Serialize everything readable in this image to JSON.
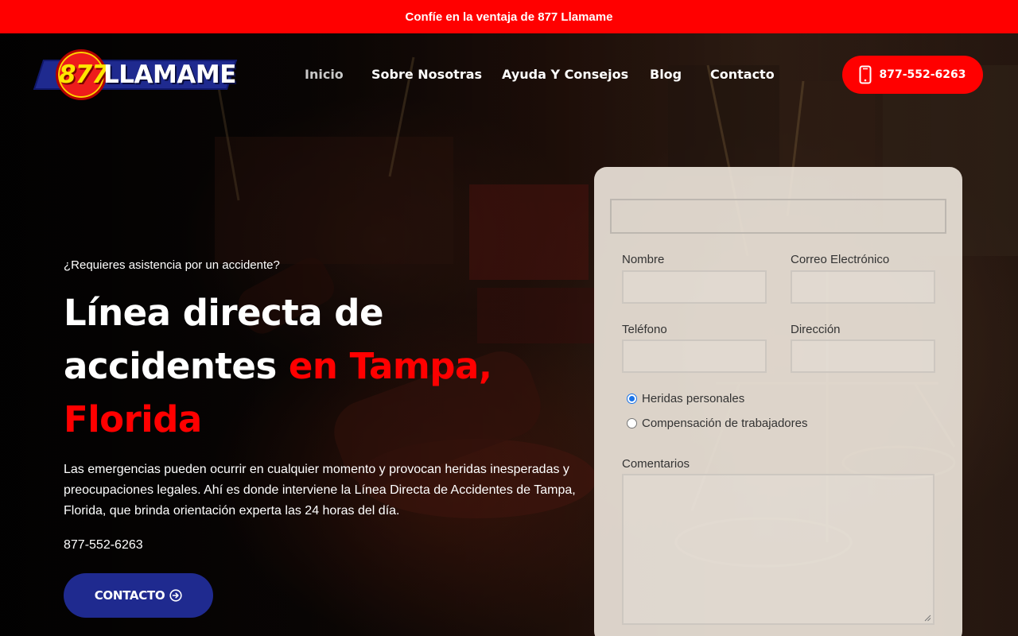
{
  "announcement": "Confíe en la ventaja de 877 Llamame",
  "logo": {
    "number": "877",
    "word": "LLAMAME"
  },
  "nav": {
    "items": [
      {
        "label": "Inicio",
        "active": true
      },
      {
        "label": "Sobre Nosotras",
        "active": false
      },
      {
        "label": "Ayuda Y Consejos",
        "active": false
      },
      {
        "label": "Blog",
        "active": false
      },
      {
        "label": "Contacto",
        "active": false
      }
    ]
  },
  "header_phone": {
    "label": "877-552-6263",
    "icon": "mobile-phone-icon"
  },
  "hero": {
    "kicker": "¿Requieres asistencia por un accidente?",
    "headline_white": "Línea directa de accidentes",
    "headline_red": "en Tampa, Florida",
    "description": "Las emergencias pueden ocurrir en cualquier momento y provocan heridas inesperadas y preocupaciones legales. Ahí es donde interviene la Línea Directa de Accidentes de Tampa, Florida, que brinda orientación experta las 24 horas del día.",
    "phone": "877-552-6263",
    "cta_label": "CONTACTO",
    "cta_icon": "arrow-right-circle-icon"
  },
  "form": {
    "top_field_value": "",
    "name_label": "Nombre",
    "email_label": "Correo Electrónico",
    "phone_label": "Teléfono",
    "address_label": "Dirección",
    "options": [
      {
        "label": "Heridas personales",
        "checked": true
      },
      {
        "label": "Compensación de trabajadores",
        "checked": false
      }
    ],
    "comments_label": "Comentarios"
  },
  "colors": {
    "brand_red": "#ff0000",
    "brand_blue": "#1f2a8f",
    "logo_yellow": "#ffe600"
  }
}
